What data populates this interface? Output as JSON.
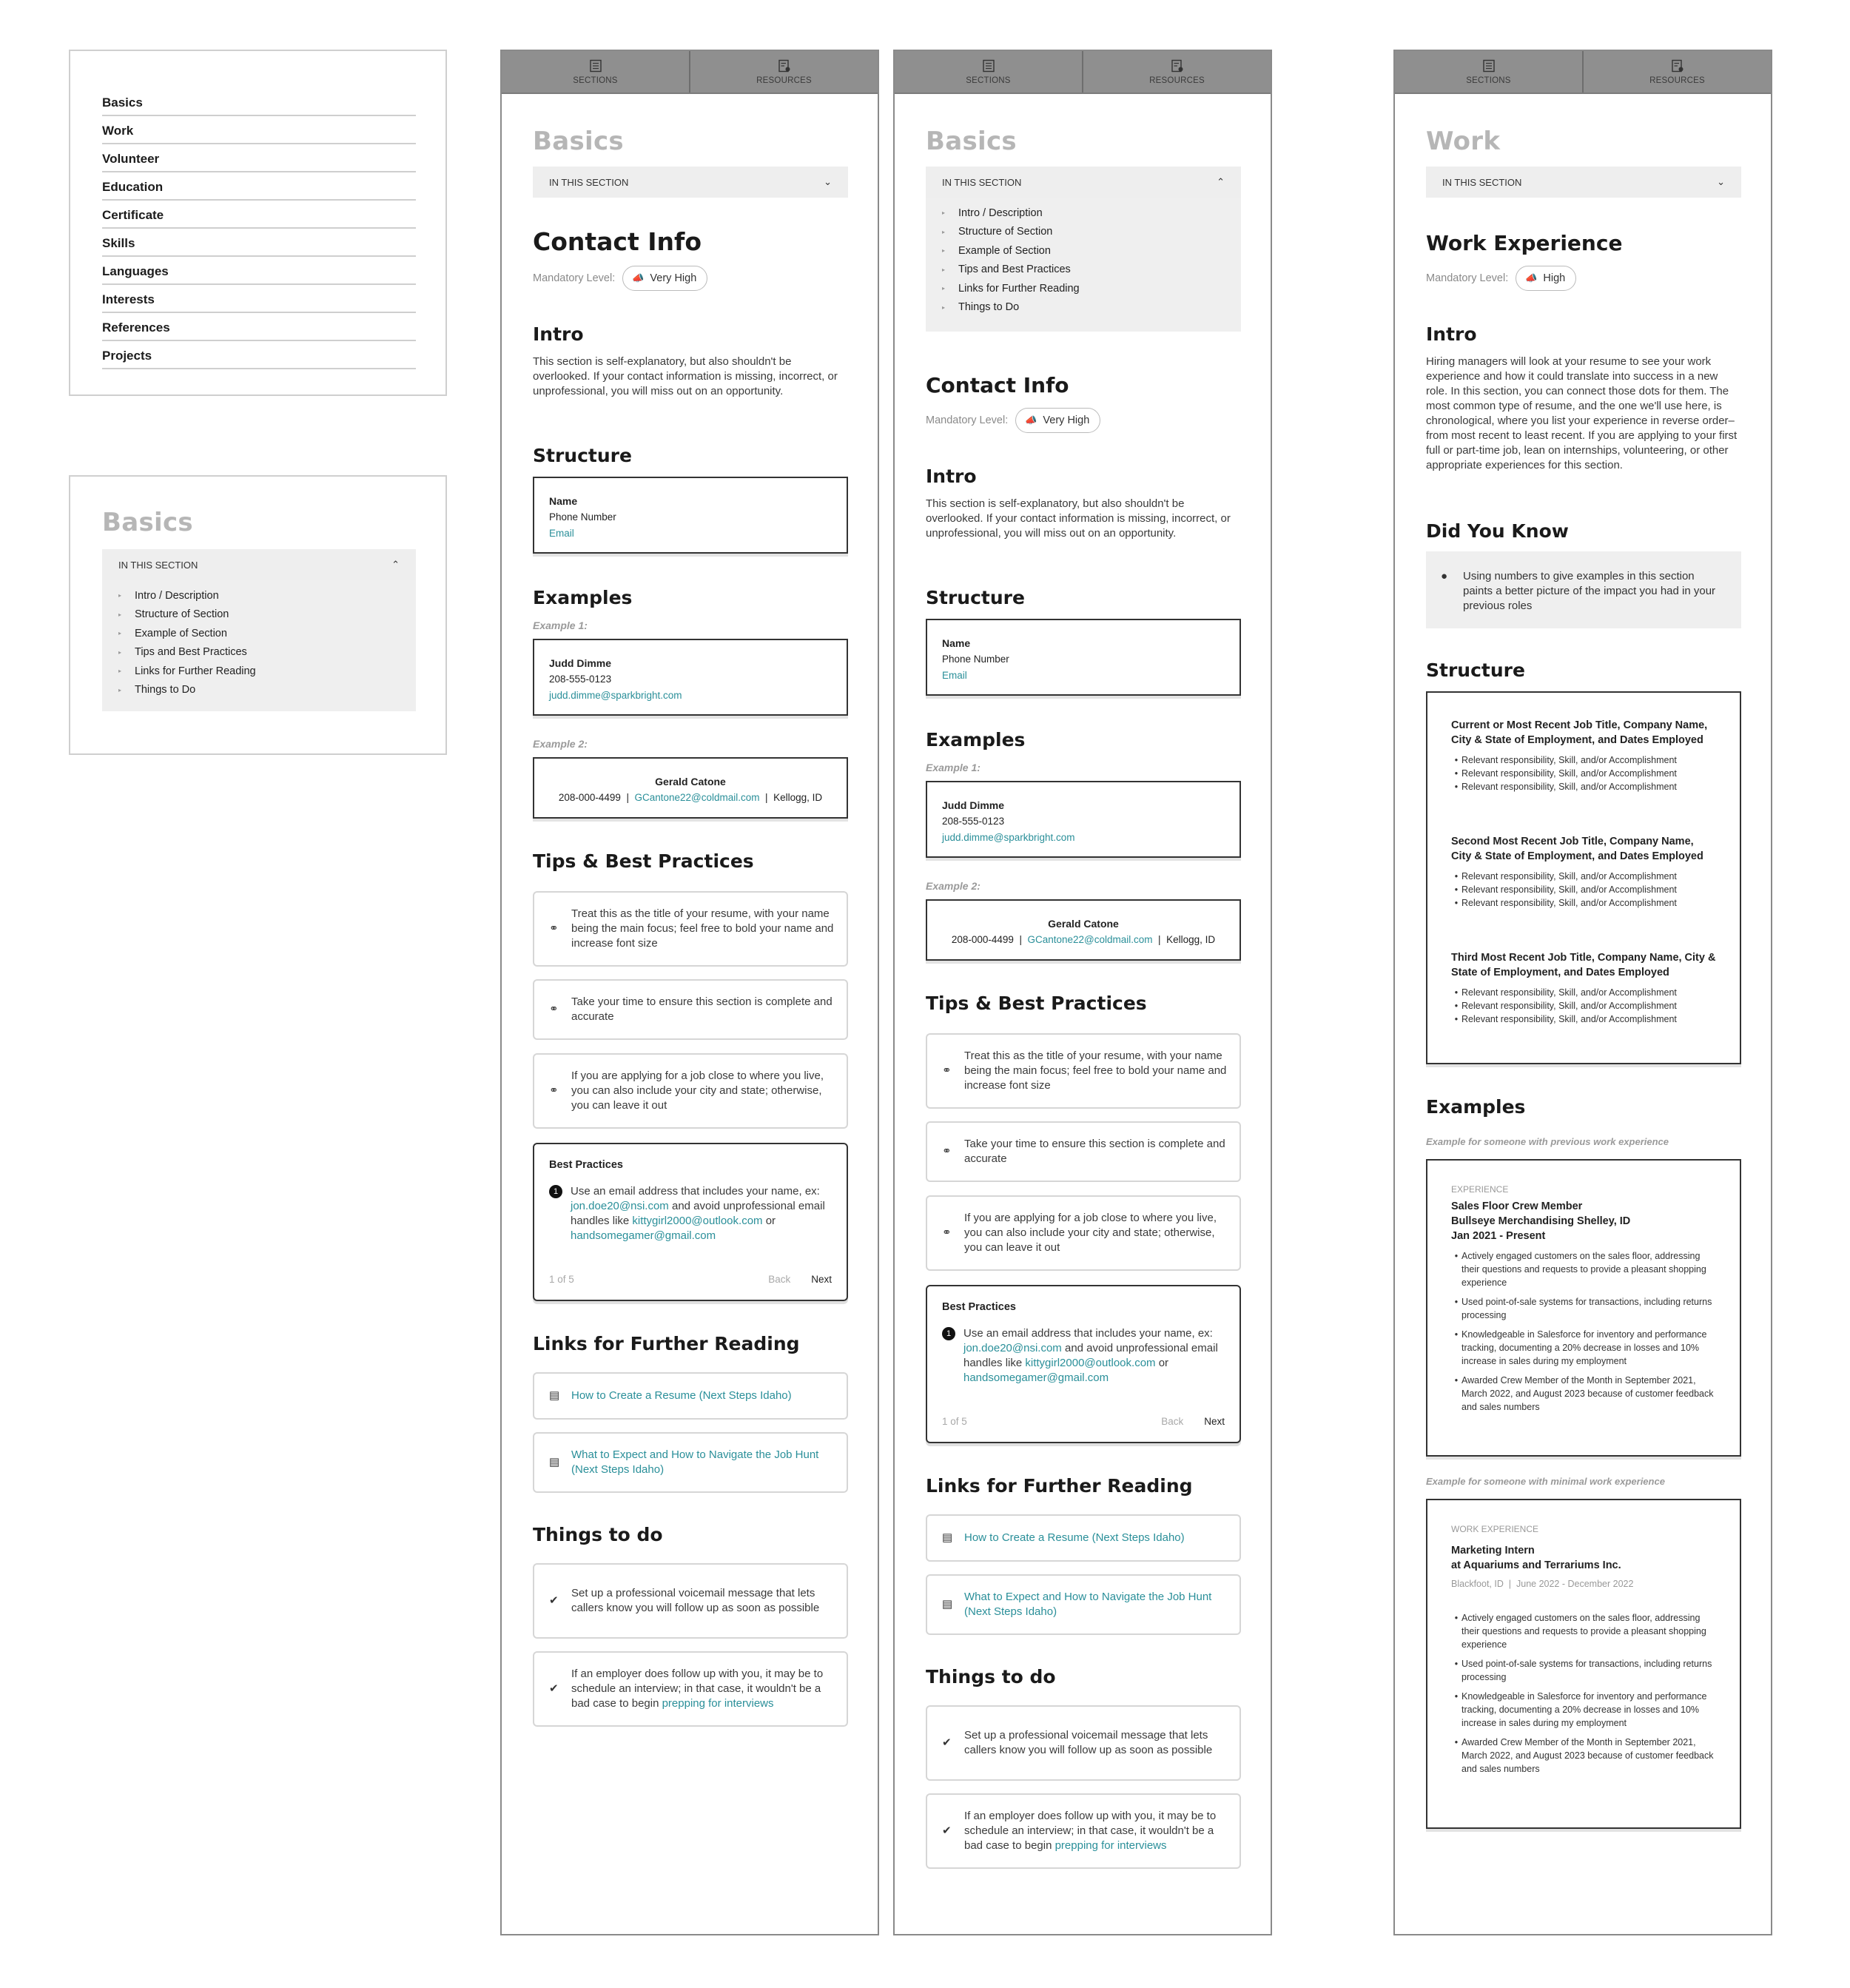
{
  "nav": {
    "items": [
      "Basics",
      "Work",
      "Volunteer",
      "Education",
      "Certificate",
      "Skills",
      "Languages",
      "Interests",
      "References",
      "Projects"
    ]
  },
  "mini": {
    "title": "Basics",
    "in_this_section": "IN THIS SECTION",
    "toc": [
      "Intro / Description",
      "Structure of Section",
      "Example of Section",
      "Tips and Best Practices",
      "Links for Further Reading",
      "Things to Do"
    ]
  },
  "tabs": {
    "sections": "SECTIONS",
    "resources": "RESOURCES"
  },
  "basics": {
    "section_title": "Basics",
    "in_this_section": "IN THIS SECTION",
    "title": "Contact Info",
    "mandatory_label": "Mandatory Level:",
    "mandatory_value": "Very High",
    "intro_heading": "Intro",
    "intro_text": "This section is self-explanatory, but also shouldn't be overlooked. If your contact information is missing, incorrect, or unprofessional, you will miss out on an opportunity.",
    "structure_heading": "Structure",
    "structure": {
      "name": "Name",
      "phone": "Phone Number",
      "email": "Email"
    },
    "examples_heading": "Examples",
    "example1_label": "Example 1:",
    "example1": {
      "name": "Judd Dimme",
      "phone": "208-555-0123",
      "email": "judd.dimme@sparkbright.com"
    },
    "example2_label": "Example 2:",
    "example2": {
      "name": "Gerald Catone",
      "phone": "208-000-4499",
      "sep": "|",
      "email": "GCantone22@coldmail.com",
      "city": "Kellogg, ID"
    },
    "tips_heading": "Tips & Best Practices",
    "tips": [
      "Treat this as the title of your resume, with your name being the main focus; feel free to bold your name and increase font size",
      "Take your time to ensure this section is complete and accurate",
      "If you are applying for a job close to where you live, you can also include your city and state; otherwise, you can leave it out"
    ],
    "best_practices": {
      "title": "Best Practices",
      "num": "1",
      "text1": "Use an email address that includes your name, ex: ",
      "link1": "jon.doe20@nsi.com",
      "text2": " and avoid unprofessional email handles like ",
      "link2": "kittygirl2000@outlook.com",
      "text3": " or ",
      "link3": "handsomegamer@gmail.com",
      "pager": "1 of 5",
      "back": "Back",
      "next": "Next"
    },
    "links_heading": "Links for Further Reading",
    "links": [
      "How to Create a Resume (Next Steps Idaho)",
      "What to Expect and How to Navigate the Job Hunt (Next Steps Idaho)"
    ],
    "todo_heading": "Things to do",
    "todo1": "Set up a professional voicemail message that lets callers know you will follow up as soon as possible",
    "todo2_text": "If an employer does follow up with you, it may be to schedule an interview; in that case, it wouldn't be a bad case to begin ",
    "todo2_link": "prepping for interviews"
  },
  "work": {
    "section_title": "Work",
    "in_this_section": "IN THIS SECTION",
    "title": "Work Experience",
    "mandatory_label": "Mandatory Level:",
    "mandatory_value": "High",
    "intro_heading": "Intro",
    "intro_text": "Hiring managers will look at your resume to see your work experience and how it could translate into success in a new role. In this section, you can connect those dots for them. The most common type of resume, and the one we'll use here, is chronological, where you list your experience in reverse order–from most recent to least recent. If you are applying to your first full or part-time job, lean on internships, volunteering, or other appropriate experiences for this section.",
    "dyk_heading": "Did You Know",
    "dyk_text": "Using numbers to give examples in this section paints a better picture of the impact you had in your previous roles",
    "structure_heading": "Structure",
    "structure_jobs": [
      "Current or Most Recent Job Title, Company Name, City & State of Employment, and Dates Employed",
      "Second Most Recent Job Title, Company Name, City & State of Employment, and Dates Employed",
      "Third Most Recent Job Title, Company Name, City & State of Employment, and Dates Employed"
    ],
    "structure_bullet": "Relevant responsibility, Skill, and/or Accomplishment",
    "examples_heading": "Examples",
    "ex1_label": "Example for someone with previous work experience",
    "ex1": {
      "kicker": "EXPERIENCE",
      "line1": "Sales Floor Crew Member",
      "line2": "Bullseye Merchandising Shelley, ID",
      "line3": "Jan 2021 - Present"
    },
    "ex2_label": "Example for someone with minimal work experience",
    "ex2": {
      "kicker": "WORK EXPERIENCE",
      "line1": "Marketing Intern",
      "line2": "at Aquariums and Terrariums Inc.",
      "meta": "Blackfoot, ID  |  June 2022 - December 2022"
    },
    "bullets": [
      "Actively engaged customers on the sales floor, addressing their questions and requests to provide a pleasant shopping experience",
      "Used point-of-sale systems for transactions, including returns processing",
      "Knowledgeable in Salesforce for inventory and performance tracking, documenting a 20% decrease in losses and 10% increase in sales during my employment",
      "Awarded Crew Member of the Month in September 2021, March 2022, and August 2023 because of customer feedback and sales numbers"
    ]
  }
}
